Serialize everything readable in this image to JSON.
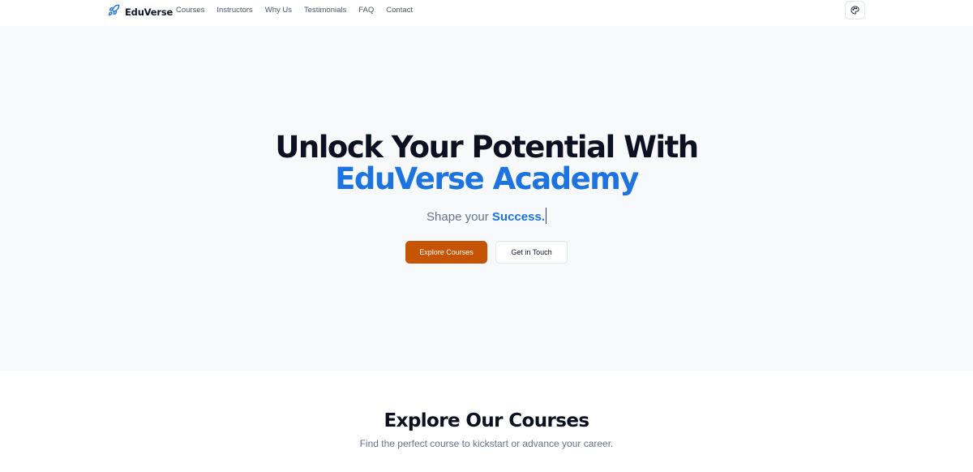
{
  "nav": {
    "brand": "EduVerse",
    "links": [
      "Courses",
      "Instructors",
      "Why Us",
      "Testimonials",
      "FAQ",
      "Contact"
    ],
    "theme_icon": "palette-icon",
    "brand_icon": "rocket-icon"
  },
  "hero": {
    "title_line1": "Unlock Your Potential With",
    "title_line2": "EduVerse Academy",
    "subtitle_prefix": "Shape your ",
    "subtitle_highlight": "Success.",
    "primary_button": "Explore Courses",
    "secondary_button": "Get in Touch"
  },
  "courses": {
    "title": "Explore Our Courses",
    "subtitle": "Find the perfect course to kickstart or advance your career."
  },
  "colors": {
    "accent": "#1d74e0",
    "primary_button": "#c75305",
    "hero_bg": "#f8f9fb"
  }
}
